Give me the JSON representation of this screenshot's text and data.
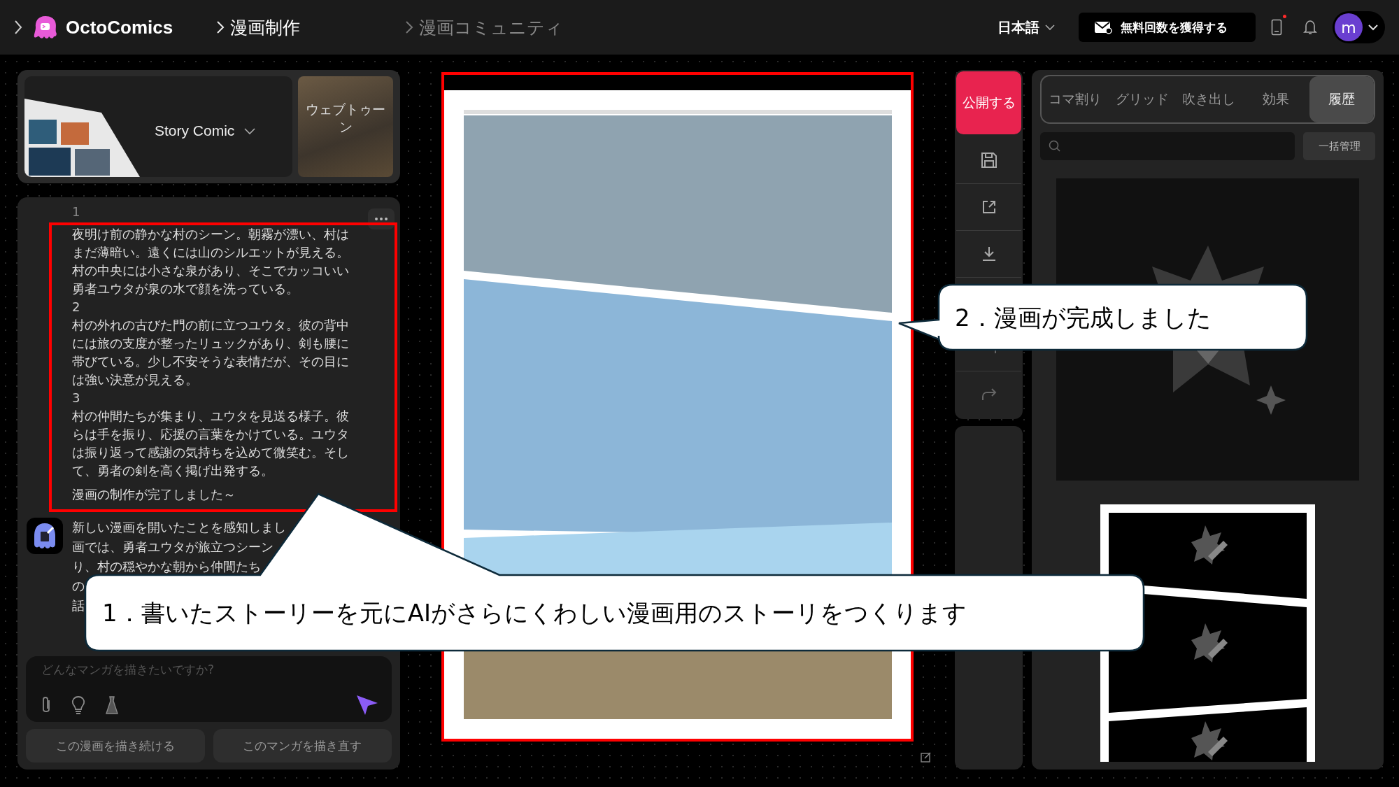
{
  "topbar": {
    "brand": "OctoComics",
    "nav": [
      {
        "label": "漫画制作",
        "selected": true
      },
      {
        "label": "漫画コミュニティ",
        "selected": false
      }
    ],
    "language": "日本語",
    "cta": "無料回数を獲得する",
    "notification_dot": true,
    "avatar_initial": "m"
  },
  "style_picker": {
    "selected_style": "Story Comic",
    "alt_style": "ウェブトゥーン"
  },
  "chat": {
    "story": {
      "sections": [
        {
          "number": "1",
          "lines": [
            "夜明け前の静かな村のシーン。朝霧が漂い、村は",
            "まだ薄暗い。遠くには山のシルエットが見える。",
            "村の中央には小さな泉があり、そこでカッコいい",
            "勇者ユウタが泉の水で顔を洗っている。"
          ]
        },
        {
          "number": "2",
          "lines": [
            "村の外れの古びた門の前に立つユウタ。彼の背中",
            "には旅の支度が整ったリュックがあり、剣も腰に",
            "帯びている。少し不安そうな表情だが、その目に",
            "は強い決意が見える。"
          ]
        },
        {
          "number": "3",
          "lines": [
            "村の仲間たちが集まり、ユウタを見送る様子。彼",
            "らは手を振り、応援の言葉をかけている。ユウタ",
            "は振り返って感謝の気持ちを込めて微笑む。そし",
            "て、勇者の剣を高く掲げ出発する。"
          ]
        }
      ],
      "closing": "漫画の制作が完了しました～"
    },
    "bot_message": {
      "lines": [
        "新しい漫画を開いたことを感知しまし",
        "画では、勇者ユウタが旅立つシーン",
        "り、村の穏やかな朝から仲間たち",
        "の",
        "話"
      ]
    },
    "input": {
      "placeholder": "どんなマンガを描きたいですか?"
    },
    "actions": [
      "この漫画を描き続ける",
      "このマンガを描き直す"
    ]
  },
  "toolbar": {
    "publish": "公開する"
  },
  "right_panel": {
    "tabs": [
      {
        "label": "コマ割り",
        "selected": false
      },
      {
        "label": "グリッド",
        "selected": false
      },
      {
        "label": "吹き出し",
        "selected": false
      },
      {
        "label": "効果",
        "selected": false
      },
      {
        "label": "履歴",
        "selected": true
      }
    ],
    "bulk_button": "一括管理"
  },
  "callouts": [
    {
      "text": "1．書いたストーリーを元にAIがさらにくわしい漫画用のストーリをつくります"
    },
    {
      "text": "2．漫画が完成しました"
    }
  ]
}
